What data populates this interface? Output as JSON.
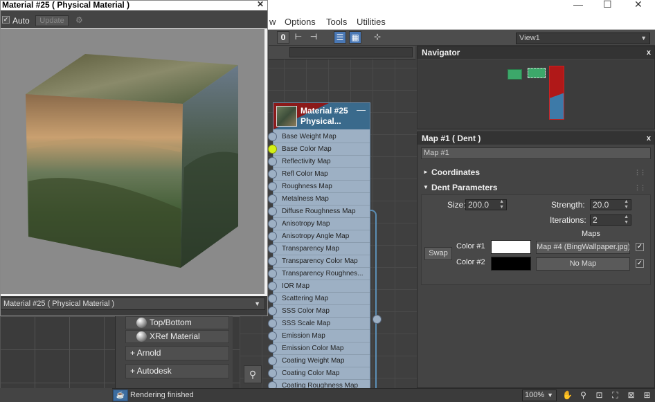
{
  "window_controls": {
    "minimize": "—",
    "maximize": "☐",
    "close": "✕"
  },
  "menubar": [
    "w",
    "Options",
    "Tools",
    "Utilities"
  ],
  "toolbar": {
    "counter": "0",
    "view_select": "View1"
  },
  "preview": {
    "title": "Material #25  ( Physical Material )",
    "auto_label": "Auto",
    "update_label": "Update",
    "material_select": "Material #25  ( Physical Material )"
  },
  "node": {
    "title_line1": "Material #25",
    "title_line2": "Physical...",
    "slots": [
      "Base Weight Map",
      "Base Color Map",
      "Reflectivity Map",
      "Refl Color Map",
      "Roughness Map",
      "Metalness Map",
      "Diffuse Roughness Map",
      "Anisotropy Map",
      "Anisotropy Angle Map",
      "Transparency Map",
      "Transparency Color Map",
      "Transparency Roughnes...",
      "IOR Map",
      "Scattering Map",
      "SSS Color Map",
      "SSS Scale Map",
      "Emission Map",
      "Emission Color Map",
      "Coating Weight Map",
      "Coating Color Map",
      "Coating Roughness Map"
    ]
  },
  "browser": {
    "items": [
      "Top/Bottom",
      "XRef Material"
    ],
    "groups": [
      "+ Arnold",
      "+ Autodesk"
    ]
  },
  "navigator": {
    "title": "Navigator",
    "close": "x"
  },
  "map_panel": {
    "title": "Map #1  ( Dent )",
    "close": "x",
    "name_field": "Map #1",
    "rollout_coordinates": "Coordinates",
    "rollout_dent": "Dent Parameters",
    "size_label": "Size:",
    "size_value": "200.0",
    "strength_label": "Strength:",
    "strength_value": "20.0",
    "iterations_label": "Iterations:",
    "iterations_value": "2",
    "maps_label": "Maps",
    "swap_label": "Swap",
    "color1_label": "Color #1",
    "color2_label": "Color #2",
    "color1_map": "Map #4 (BingWallpaper.jpg)",
    "color2_map": "No Map",
    "color1_swatch": "#ffffff",
    "color2_swatch": "#000000"
  },
  "status": {
    "text": "Rendering finished",
    "zoom": "100%"
  },
  "colors": {
    "accent_blue": "#4a78b5",
    "node_header": "#3a6a8c",
    "node_red": "#8b1a1a",
    "socket_active": "#d4f017"
  }
}
